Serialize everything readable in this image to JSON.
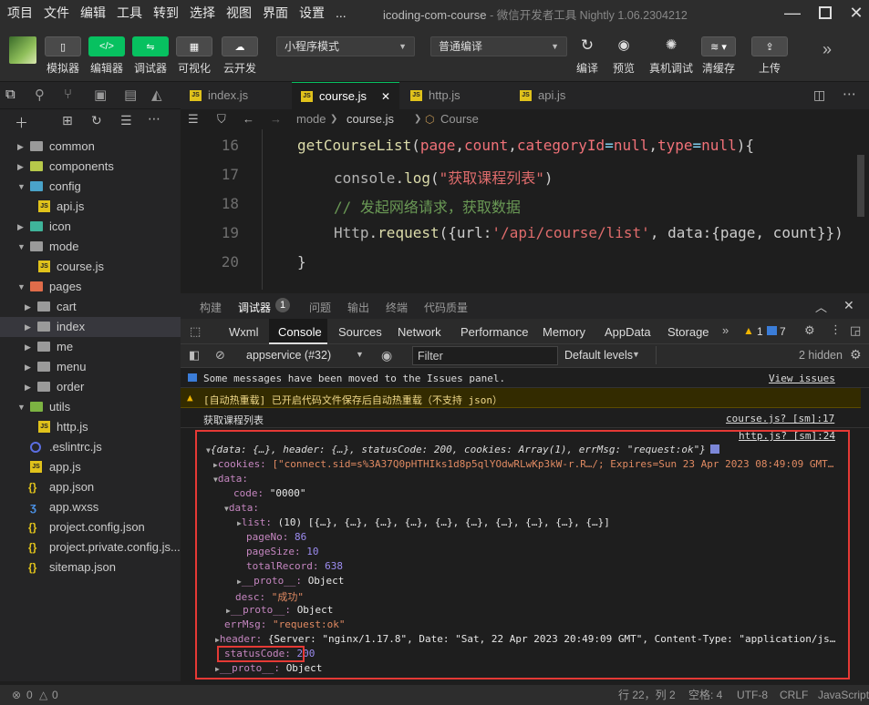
{
  "menu": [
    "项目",
    "文件",
    "编辑",
    "工具",
    "转到",
    "选择",
    "视图",
    "界面",
    "设置",
    "..."
  ],
  "window": {
    "app_name": "icoding-com-course",
    "app_suffix": "- 微信开发者工具 Nightly 1.06.2304212"
  },
  "toolbar": {
    "simulator": "模拟器",
    "editor": "编辑器",
    "debugger": "调试器",
    "visual": "可视化",
    "cloud": "云开发",
    "mode_select": "小程序模式",
    "compile_select": "普通编译",
    "compile": "编译",
    "preview": "预览",
    "real_debug": "真机调试",
    "clear_cache": "清缓存",
    "upload": "上传"
  },
  "sidebar": {
    "items": [
      {
        "label": "common"
      },
      {
        "label": "components"
      },
      {
        "label": "config"
      },
      {
        "label": "api.js"
      },
      {
        "label": "icon"
      },
      {
        "label": "mode"
      },
      {
        "label": "course.js"
      },
      {
        "label": "pages"
      },
      {
        "label": "cart"
      },
      {
        "label": "index"
      },
      {
        "label": "me"
      },
      {
        "label": "menu"
      },
      {
        "label": "order"
      },
      {
        "label": "utils"
      },
      {
        "label": "http.js"
      },
      {
        "label": ".eslintrc.js"
      },
      {
        "label": "app.js"
      },
      {
        "label": "app.json"
      },
      {
        "label": "app.wxss"
      },
      {
        "label": "project.config.json"
      },
      {
        "label": "project.private.config.js..."
      },
      {
        "label": "sitemap.json"
      }
    ]
  },
  "tabs": [
    {
      "label": "index.js"
    },
    {
      "label": "course.js"
    },
    {
      "label": "http.js"
    },
    {
      "label": "api.js"
    }
  ],
  "breadcrumb": {
    "folder": "mode",
    "file": "course.js",
    "symbol": "Course"
  },
  "editor": {
    "line_numbers": [
      "16",
      "17",
      "18",
      "19",
      "20"
    ],
    "line16": {
      "fn": "getCourseList",
      "open": "(",
      "p1": "page",
      "c1": ",",
      "p2": "count",
      "c2": ",",
      "p3": "categoryId",
      "eq1": "=",
      "v1": "null",
      "c3": ",",
      "p4": "type",
      "eq2": "=",
      "v2": "null",
      "close": "){"
    },
    "line17": {
      "obj": "console",
      "dot": ".",
      "method": "log",
      "open": "(",
      "str": "\"获取课程列表\"",
      "close": ")"
    },
    "line18": {
      "comment": "// 发起网络请求，获取数据"
    },
    "line19": {
      "obj": "Http",
      "dot": ".",
      "method": "request",
      "rest1": "({",
      "k1": "url",
      "colon1": ":",
      "str": "'/api/course/list'",
      "rest2": ", ",
      "k2": "data",
      "colon2": ":",
      "obj2": "{page, count}",
      "close": "})"
    },
    "line20": {
      "brace": "}"
    }
  },
  "devtools": {
    "top_tabs": [
      "构建",
      "调试器",
      "问题",
      "输出",
      "终端",
      "代码质量"
    ],
    "debugger_badge": "1",
    "panel_tabs": [
      "Wxml",
      "Console",
      "Sources",
      "Network",
      "Performance",
      "Memory",
      "AppData",
      "Storage"
    ],
    "warn_count": "1",
    "info_count": "7",
    "context": "appservice (#32)",
    "filter_placeholder": "Filter",
    "levels": "Default levels",
    "hidden": "2 hidden"
  },
  "console": {
    "issues_msg": "Some messages have been moved to the Issues panel.",
    "issues_link": "View issues",
    "warn_msg": "[自动热重载] 已开启代码文件保存后自动热重载（不支持 json）",
    "log1": "获取课程列表",
    "log1_src": "course.js? [sm]:17",
    "log2_src": "http.js? [sm]:24",
    "obj_summary": "{data: {…}, header: {…}, statusCode: 200, cookies: Array(1), errMsg: \"request:ok\"}",
    "cookies_key": "cookies:",
    "cookies_val": "[\"connect.sid=s%3A37Q0pHTHIks1d8p5qlYOdwRLwKp3kW-r.R…/; Expires=Sun 23 Apr 2023 08:49:09 GMT…",
    "data_key": "data:",
    "code_key": "code:",
    "code_val": "\"0000\"",
    "data2_key": "data:",
    "list_key": "list:",
    "list_val": "(10) [{…}, {…}, {…}, {…}, {…}, {…}, {…}, {…}, {…}, {…}]",
    "pageNo_key": "pageNo:",
    "pageNo_val": "86",
    "pageSize_key": "pageSize:",
    "pageSize_val": "10",
    "total_key": "totalRecord:",
    "total_val": "638",
    "proto_key": "__proto__:",
    "proto_val": "Object",
    "desc_key": "desc:",
    "desc_val": "\"成功\"",
    "errMsg_key": "errMsg:",
    "errMsg_val": "\"request:ok\"",
    "header_key": "header:",
    "header_val": "{Server: \"nginx/1.17.8\", Date: \"Sat, 22 Apr 2023 20:49:09 GMT\", Content-Type: \"application/js…",
    "status_key": "statusCode:",
    "status_val": "200"
  },
  "statusbar": {
    "errors": "0",
    "warnings": "0",
    "position": "行 22，列 2",
    "spaces": "空格: 4",
    "encoding": "UTF-8",
    "eol": "CRLF",
    "language": "JavaScript"
  },
  "colors": {
    "accent": "#07c160",
    "highlight": "#e53935"
  }
}
